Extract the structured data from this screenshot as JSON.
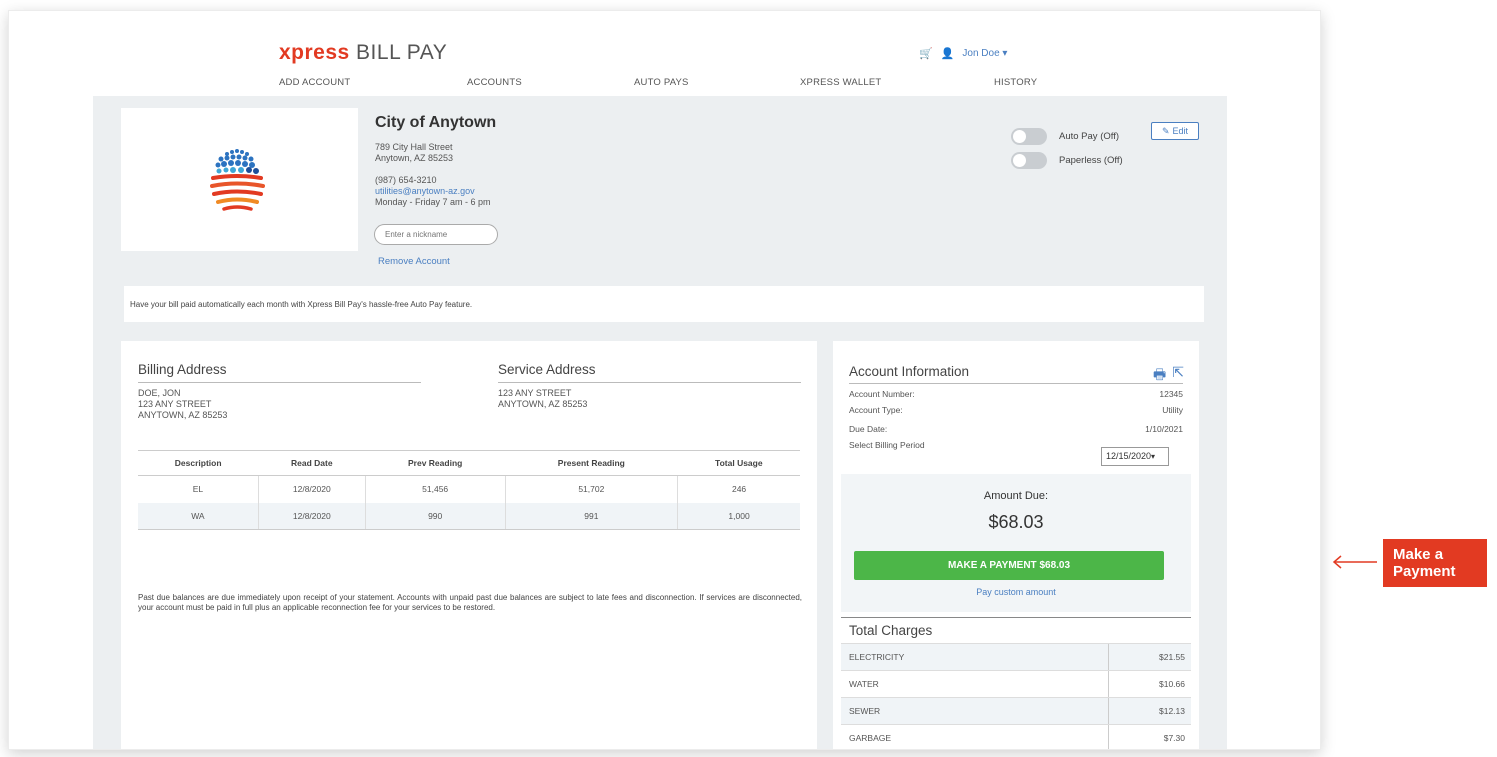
{
  "header": {
    "brand": "xpress",
    "brand_rest": " BILL PAY",
    "user_name": "Jon Doe ▾",
    "nav": [
      "ADD ACCOUNT",
      "ACCOUNTS",
      "AUTO PAYS",
      "XPRESS WALLET",
      "HISTORY"
    ]
  },
  "account_header": {
    "org_name": "City of Anytown",
    "street": "789 City Hall Street",
    "city": "Anytown, AZ 85253",
    "phone": "(987) 654-3210",
    "email": "utilities@anytown-az.gov",
    "hours": "Monday - Friday 7 am - 6 pm",
    "nickname_placeholder": "Enter a nickname",
    "remove_label": "Remove Account",
    "autopay_label": "Auto Pay (Off)",
    "paperless_label": "Paperless (Off)",
    "edit_label": "Edit"
  },
  "promo_text": "Have your bill paid automatically each month with Xpress Bill Pay's hassle-free Auto Pay feature.",
  "billing": {
    "billing_title": "Billing Address",
    "billing_lines": [
      "DOE, JON",
      "123 ANY STREET",
      "ANYTOWN, AZ 85253"
    ],
    "service_title": "Service Address",
    "service_lines": [
      "123 ANY STREET",
      "ANYTOWN, AZ 85253"
    ],
    "columns": [
      "Description",
      "Read Date",
      "Prev Reading",
      "Present Reading",
      "Total Usage"
    ],
    "rows": [
      [
        "EL",
        "12/8/2020",
        "51,456",
        "51,702",
        "246"
      ],
      [
        "WA",
        "12/8/2020",
        "990",
        "991",
        "1,000"
      ]
    ],
    "notice": "Past due balances are due immediately upon receipt of your statement. Accounts with unpaid past due balances are subject to late fees and disconnection. If services are disconnected, your account must be paid in full plus an applicable reconnection fee for your services to be restored."
  },
  "account_info": {
    "title": "Account Information",
    "account_number_label": "Account Number:",
    "account_number": "12345",
    "account_type_label": "Account Type:",
    "account_type": "Utility",
    "due_date_label": "Due Date:",
    "due_date": "1/10/2021",
    "billing_period_label": "Select Billing Period",
    "billing_period": "12/15/2020",
    "amount_due_label": "Amount Due:",
    "amount_due": "$68.03",
    "pay_button": "MAKE A PAYMENT $68.03",
    "custom_amount": "Pay custom amount",
    "charges_title": "Total Charges",
    "charges": [
      {
        "name": "ELECTRICITY",
        "amount": "$21.55"
      },
      {
        "name": "WATER",
        "amount": "$10.66"
      },
      {
        "name": "SEWER",
        "amount": "$12.13"
      },
      {
        "name": "GARBAGE",
        "amount": "$7.30"
      }
    ]
  },
  "callout": {
    "line1": "Make a",
    "line2": "Payment"
  },
  "colors": {
    "brand": "#e23a22",
    "link": "#4a7fc1",
    "pay_button": "#4cb648",
    "panel_bg": "#eceff1"
  }
}
